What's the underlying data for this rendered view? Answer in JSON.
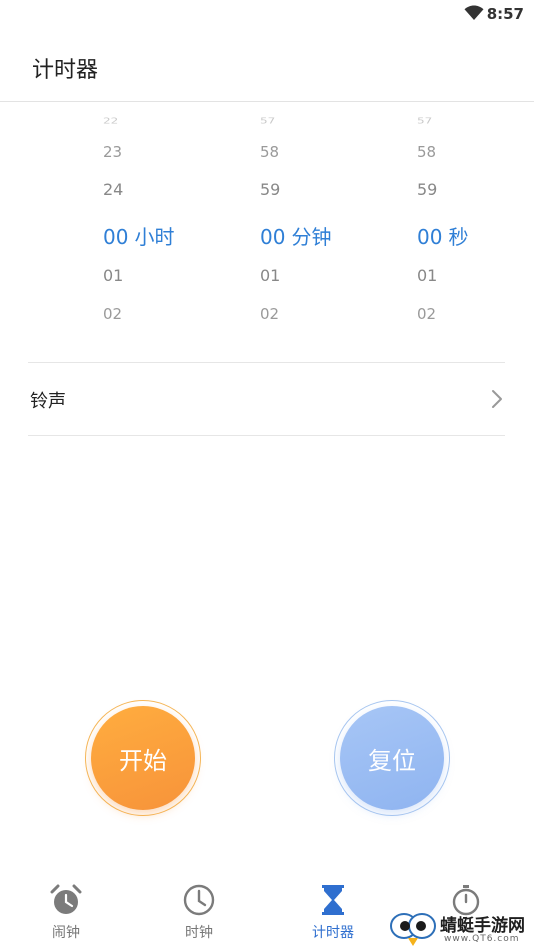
{
  "status_bar": {
    "time": "8:57",
    "wifi_icon": "wifi-icon"
  },
  "header": {
    "title": "计时器"
  },
  "pickers": {
    "hours": {
      "above": [
        "22",
        "23",
        "24"
      ],
      "selected": "00",
      "unit": "小时",
      "below": [
        "01",
        "02"
      ]
    },
    "minutes": {
      "above": [
        "57",
        "58",
        "59"
      ],
      "selected": "00",
      "unit": "分钟",
      "below": [
        "01",
        "02"
      ]
    },
    "seconds": {
      "above": [
        "57",
        "58",
        "59"
      ],
      "selected": "00",
      "unit": "秒",
      "below": [
        "01",
        "02"
      ]
    }
  },
  "ringtone": {
    "label": "铃声",
    "chevron_icon": "chevron-right-icon"
  },
  "buttons": {
    "start_label": "开始",
    "reset_label": "复位"
  },
  "nav": {
    "items": [
      {
        "label": "闹钟",
        "icon": "alarm-clock-icon"
      },
      {
        "label": "时钟",
        "icon": "clock-icon"
      },
      {
        "label": "计时器",
        "icon": "hourglass-icon"
      },
      {
        "label": "",
        "icon": "stopwatch-icon"
      }
    ]
  },
  "watermark": {
    "text": "蜻蜓手游网",
    "sub": "www.QT6.com"
  },
  "colors": {
    "accent": "#2f7fd6",
    "start": "#f7933a",
    "reset": "#8fb4f0",
    "nav_active": "#2f6fcf"
  }
}
